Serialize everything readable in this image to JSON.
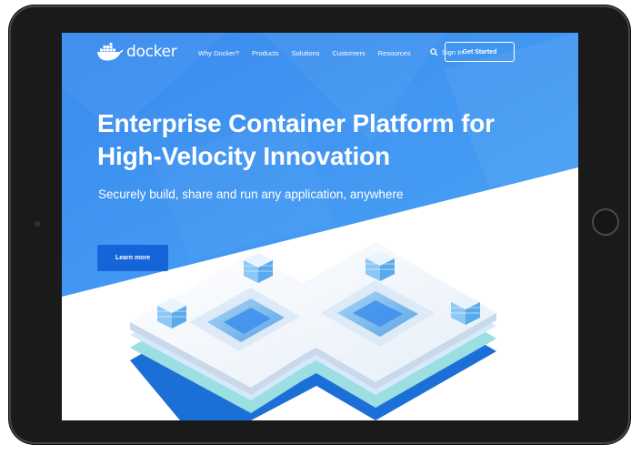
{
  "nav": {
    "logo_text": "docker",
    "links": [
      "Why Docker?",
      "Products",
      "Solutions",
      "Customers",
      "Resources"
    ],
    "sign_in": "Sign In",
    "cta": "Get Started"
  },
  "hero": {
    "headline_line1": "Enterprise Container Platform for",
    "headline_line2": "High-Velocity Innovation",
    "subheadline": "Securely build, share and run any application, anywhere",
    "button": "Learn more"
  },
  "colors": {
    "hero_blue": "#3b8ef0",
    "button_blue": "#1565d8",
    "frame": "#1a1a1a"
  },
  "icons": [
    "docker-whale-icon",
    "search-icon",
    "container-cube-icon"
  ]
}
